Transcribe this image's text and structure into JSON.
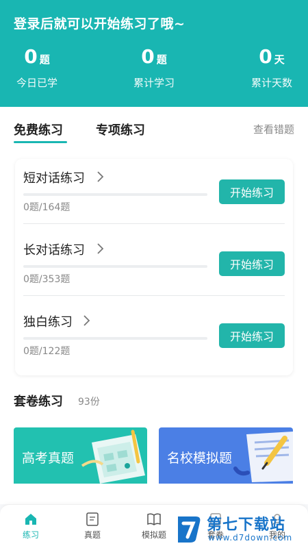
{
  "header": {
    "title": "登录后就可以开始练习了哦~",
    "stats": [
      {
        "value": "0",
        "unit": "题",
        "label": "今日已学"
      },
      {
        "value": "0",
        "unit": "题",
        "label": "累计学习"
      },
      {
        "value": "0",
        "unit": "天",
        "label": "累计天数"
      }
    ]
  },
  "tabs": {
    "free": "免费练习",
    "special": "专项练习",
    "wrong_link": "查看错题"
  },
  "practice": [
    {
      "title": "短对话练习",
      "count": "0题/164题",
      "progress": 0,
      "button": "开始练习"
    },
    {
      "title": "长对话练习",
      "count": "0题/353题",
      "progress": 0,
      "button": "开始练习"
    },
    {
      "title": "独白练习",
      "count": "0题/122题",
      "progress": 0,
      "button": "开始练习"
    }
  ],
  "paper_section": {
    "title": "套卷练习",
    "count": "93份"
  },
  "banners": [
    {
      "text": "高考真题",
      "color": "#22c1b0"
    },
    {
      "text": "名校模拟题",
      "color": "#4b7fe5"
    }
  ],
  "nav": [
    {
      "label": "练习",
      "icon": "home-icon",
      "active": true
    },
    {
      "label": "真题",
      "icon": "exam-paper-icon",
      "active": false
    },
    {
      "label": "模拟题",
      "icon": "book-icon",
      "active": false
    },
    {
      "label": "套卷",
      "icon": "paper-set-icon",
      "active": false
    },
    {
      "label": "我的",
      "icon": "user-icon",
      "active": false
    }
  ],
  "watermark": {
    "title": "第七下载站",
    "url": "www.d7down.com"
  },
  "colors": {
    "accent": "#19b6b2",
    "button": "#22b5aa",
    "banner_green": "#22c1b0",
    "banner_blue": "#4b7fe5"
  }
}
